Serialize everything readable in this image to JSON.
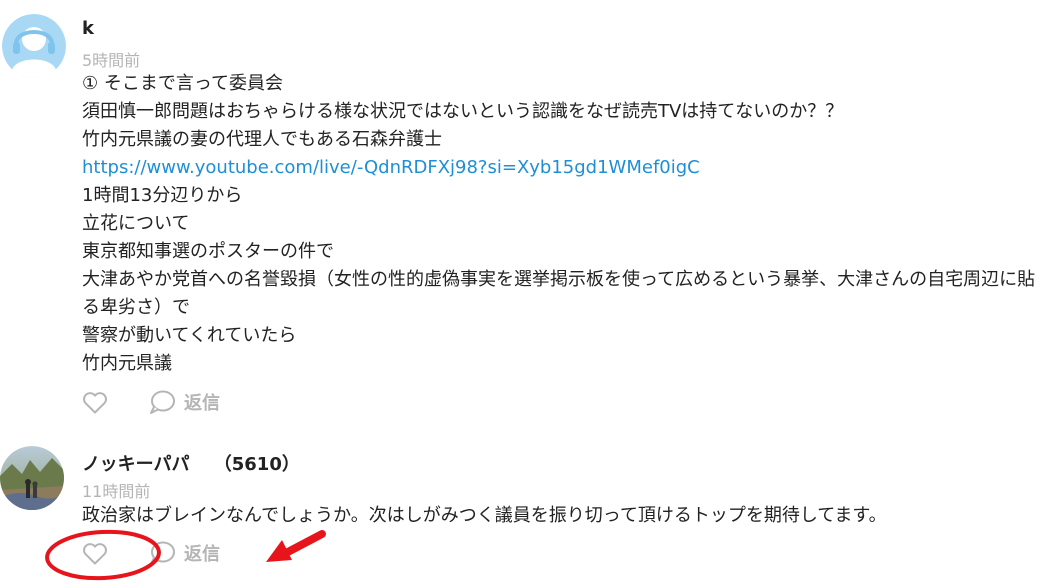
{
  "comments": [
    {
      "author": "k",
      "time": "5時間前",
      "lines": [
        "① そこまで言って委員会",
        "須田慎一郎問題はおちゃらける様な状況ではないという認識をなぜ読売TVは持てないのか？？",
        "竹内元県議の妻の代理人でもある石森弁護士",
        "https://www.youtube.com/live/-QdnRDFXj98?si=Xyb15gd1WMef0igC",
        "1時間13分辺りから",
        "立花について",
        "東京都知事選のポスターの件で",
        "大津あやか党首への名誉毀損（女性の性的虚偽事実を選挙掲示板を使って広めるという暴挙、大津さんの自宅周辺に貼る卑劣さ）で",
        "警察が動いてくれていたら",
        "竹内元県議"
      ],
      "reply_label": "返信"
    },
    {
      "author": "ノッキーパパ",
      "author_score": "（5610）",
      "time": "11時間前",
      "lines": [
        "政治家はブレインなんでしょうか。次はしがみつく議員を振り切って頂けるトップを期待してます。"
      ],
      "reply_label": "返信"
    }
  ],
  "icons": {
    "like": "heart-outline-icon",
    "reply": "speech-bubble-icon",
    "default_avatar": "default-user-avatar-icon"
  },
  "colors": {
    "link": "#1e8fd6",
    "muted": "#b5b5b5",
    "annotation": "#e8141c",
    "avatar_blue": "#9fd3f2"
  }
}
